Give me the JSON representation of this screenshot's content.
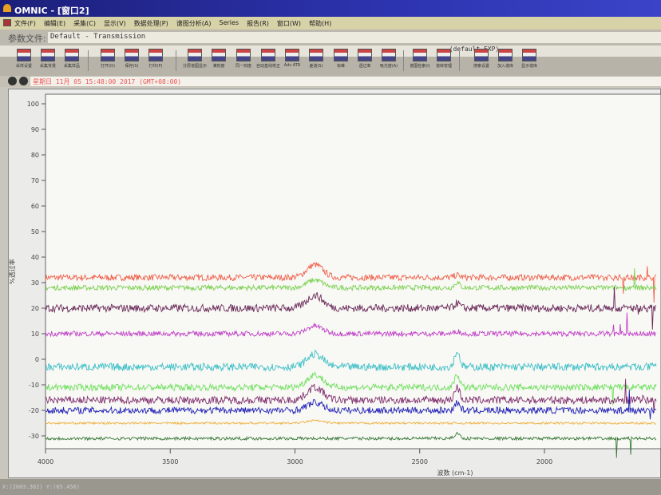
{
  "window": {
    "title": "OMNIC - [窗口2]"
  },
  "menu": [
    "文件(F)",
    "编辑(E)",
    "采集(C)",
    "显示(V)",
    "数据处理(P)",
    "谱图分析(A)",
    "Series",
    "报告(R)",
    "窗口(W)",
    "帮助(H)"
  ],
  "param": {
    "label": "参数文件:",
    "value": "Default - Transmission"
  },
  "experiment": "(default.EXP)",
  "toolbar": [
    {
      "label": "采样设置"
    },
    {
      "label": "采集背景"
    },
    {
      "label": "采集样品"
    },
    {
      "label": "打开(O)"
    },
    {
      "label": "保存(S)"
    },
    {
      "label": "打印(P)"
    },
    {
      "label": "分层谱图显示"
    },
    {
      "label": "满刻度"
    },
    {
      "label": "同一刻度"
    },
    {
      "label": "自动基线校正"
    },
    {
      "label": "Adv ATR"
    },
    {
      "label": "差谱(S)"
    },
    {
      "label": "标峰"
    },
    {
      "label": "透过率"
    },
    {
      "label": "吸光度(A)"
    },
    {
      "label": "谱图检索(I)"
    },
    {
      "label": "谱库管理"
    },
    {
      "label": "搜索设置"
    },
    {
      "label": "加入谱库"
    },
    {
      "label": "显示谱库"
    }
  ],
  "date": "星期日 11月 05 15:48:00 2017 (GMT+08:00)",
  "status": "X:(2003.302) Y:(65.456)",
  "chart_data": {
    "type": "line",
    "xlabel": "波数 (cm-1)",
    "ylabel": "%透过率",
    "xlim": [
      4000,
      1550
    ],
    "ylim": [
      -35,
      102
    ],
    "xticks": [
      4000,
      3500,
      3000,
      2500,
      2000
    ],
    "yticks": [
      100,
      90,
      80,
      70,
      60,
      50,
      40,
      30,
      20,
      10,
      0,
      -10,
      -20,
      -30
    ],
    "series": [
      {
        "color": "#f0604a",
        "baseline": 32,
        "noise": 1.2,
        "peaks": [
          [
            2920,
            5
          ],
          [
            2350,
            1
          ]
        ]
      },
      {
        "color": "#7ad050",
        "baseline": 28,
        "noise": 1.0,
        "peaks": [
          [
            2920,
            3
          ],
          [
            2350,
            2
          ]
        ]
      },
      {
        "color": "#6a2a5a",
        "baseline": 20,
        "noise": 1.5,
        "peaks": [
          [
            2920,
            5
          ],
          [
            2350,
            2
          ]
        ]
      },
      {
        "color": "#c040c8",
        "baseline": 10,
        "noise": 1.0,
        "peaks": [
          [
            2920,
            3
          ],
          [
            2350,
            1
          ]
        ]
      },
      {
        "color": "#40c0c8",
        "baseline": -3,
        "noise": 1.5,
        "peaks": [
          [
            2920,
            5
          ],
          [
            2350,
            6
          ]
        ]
      },
      {
        "color": "#70e060",
        "baseline": -11,
        "noise": 1.3,
        "peaks": [
          [
            2920,
            5
          ],
          [
            2350,
            5
          ]
        ]
      },
      {
        "color": "#803070",
        "baseline": -16,
        "noise": 1.5,
        "peaks": [
          [
            2920,
            5
          ],
          [
            2350,
            5
          ]
        ]
      },
      {
        "color": "#2020b8",
        "baseline": -20,
        "noise": 1.3,
        "peaks": [
          [
            2920,
            3
          ],
          [
            2350,
            3
          ]
        ]
      },
      {
        "color": "#f0b040",
        "baseline": -25,
        "noise": 0.4,
        "peaks": [
          [
            2920,
            1
          ]
        ]
      },
      {
        "color": "#3a7a3a",
        "baseline": -31,
        "noise": 0.6,
        "peaks": [
          [
            2350,
            2
          ]
        ]
      }
    ]
  }
}
